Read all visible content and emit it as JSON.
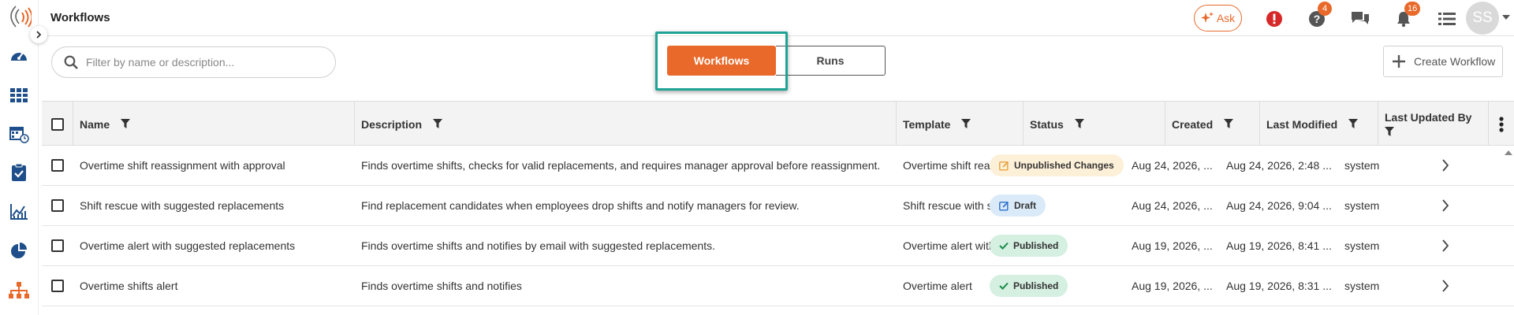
{
  "header": {
    "title": "Workflows",
    "ask_label": "Ask",
    "help_badge": "4",
    "notifications_badge": "16",
    "avatar_initials": "SS"
  },
  "colors": {
    "accent": "#e8692a",
    "highlight": "#1fa396",
    "alert": "#d62828"
  },
  "toolbar": {
    "search_placeholder": "Filter by name or description...",
    "tab_workflows": "Workflows",
    "tab_runs": "Runs",
    "create_label": "Create Workflow"
  },
  "table": {
    "columns": {
      "name": "Name",
      "description": "Description",
      "template": "Template",
      "status": "Status",
      "created": "Created",
      "last_modified": "Last Modified",
      "last_updated_by": "Last Updated By"
    },
    "rows": [
      {
        "name": "Overtime shift reassignment with approval",
        "description": "Finds overtime shifts, checks for valid replacements, and requires manager approval before reassignment.",
        "template": "Overtime shift reassi...",
        "status": "Unpublished Changes",
        "status_kind": "unpublished",
        "created": "Aug 24, 2026, ...",
        "last_modified": "Aug 24, 2026, 2:48 ...",
        "updated_by": "system"
      },
      {
        "name": "Shift rescue with suggested replacements",
        "description": "Find replacement candidates when employees drop shifts and notify managers for review.",
        "template": "Shift rescue with sug...",
        "status": "Draft",
        "status_kind": "draft",
        "created": "Aug 24, 2026, ...",
        "last_modified": "Aug 24, 2026, 9:04 ...",
        "updated_by": "system"
      },
      {
        "name": "Overtime alert with suggested replacements",
        "description": "Finds overtime shifts and notifies by email with suggested replacements.",
        "template": "Overtime alert with s...",
        "status": "Published",
        "status_kind": "published",
        "created": "Aug 19, 2026, ...",
        "last_modified": "Aug 19, 2026, 8:41 ...",
        "updated_by": "system"
      },
      {
        "name": "Overtime shifts alert",
        "description": "Finds overtime shifts and notifies",
        "template": "Overtime alert",
        "status": "Published",
        "status_kind": "published",
        "created": "Aug 19, 2026, ...",
        "last_modified": "Aug 19, 2026, 8:31 ...",
        "updated_by": "system"
      }
    ]
  }
}
